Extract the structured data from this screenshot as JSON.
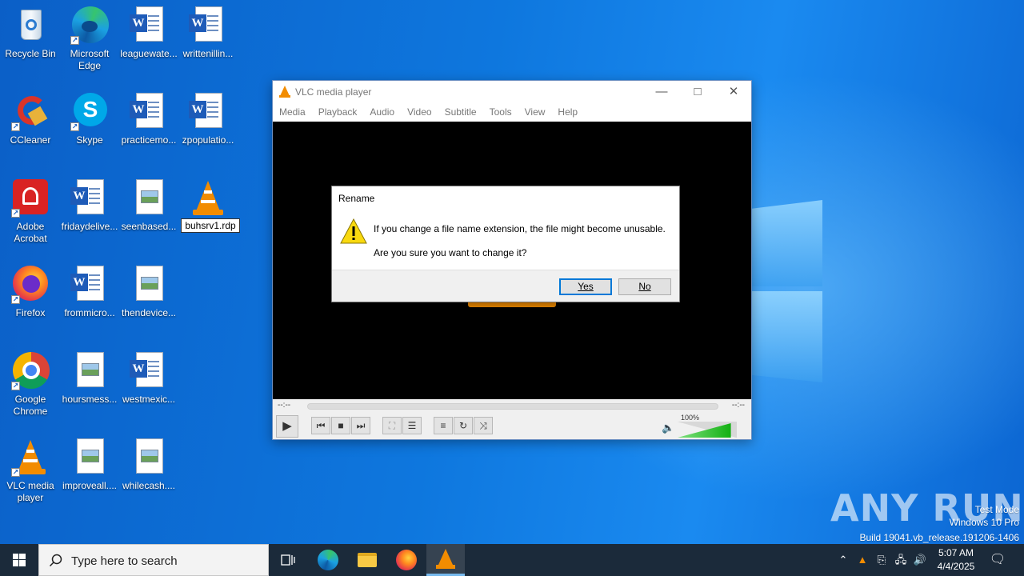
{
  "desktop": {
    "icons": [
      {
        "label": "Recycle Bin"
      },
      {
        "label": "Microsoft Edge"
      },
      {
        "label": "leaguewate..."
      },
      {
        "label": "writtenillin..."
      },
      {
        "label": "CCleaner"
      },
      {
        "label": "Skype"
      },
      {
        "label": "practicemo..."
      },
      {
        "label": "zpopulatio..."
      },
      {
        "label": "Adobe Acrobat"
      },
      {
        "label": "fridaydelive..."
      },
      {
        "label": "seenbased..."
      },
      {
        "label": "buhsrv1.rdp"
      },
      {
        "label": "Firefox"
      },
      {
        "label": "frommicro..."
      },
      {
        "label": "thendevice..."
      },
      {
        "label": "Google Chrome"
      },
      {
        "label": "hoursmess..."
      },
      {
        "label": "westmexic..."
      },
      {
        "label": "VLC media player"
      },
      {
        "label": "improveall...."
      },
      {
        "label": "whilecash...."
      }
    ]
  },
  "vlc": {
    "title": "VLC media player",
    "menu": [
      "Media",
      "Playback",
      "Audio",
      "Video",
      "Subtitle",
      "Tools",
      "View",
      "Help"
    ],
    "time_elapsed": "--:--",
    "time_total": "--:--",
    "volume_label": "100%",
    "volume_level": 0.9
  },
  "dialog": {
    "title": "Rename",
    "message_line1": "If you change a file name extension, the file might become unusable.",
    "message_line2": "Are you sure you want to change it?",
    "yes_label": "Yes",
    "no_label": "No"
  },
  "watermark": {
    "brand": "ANY RUN",
    "line1": "Test Mode",
    "line2": "Windows 10 Pro",
    "line3": "Build 19041.vb_release.191206-1406"
  },
  "taskbar": {
    "search_placeholder": "Type here to search",
    "time": "5:07 AM",
    "date": "4/4/2025"
  }
}
